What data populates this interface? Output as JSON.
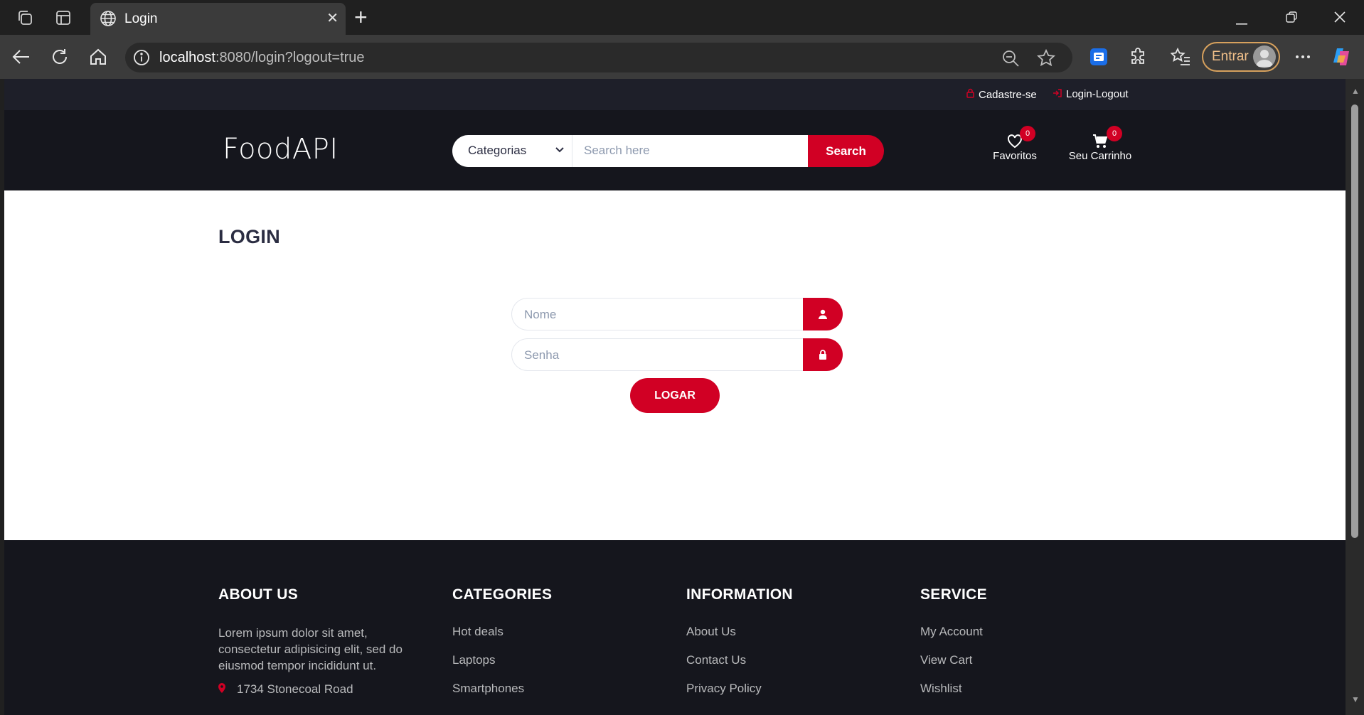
{
  "browser": {
    "tab_title": "Login",
    "url_host": "localhost",
    "url_rest": ":8080/login?logout=true",
    "profile_label": "Entrar"
  },
  "site": {
    "top_links": {
      "register": "Cadastre-se",
      "login_logout": "Login-Logout"
    },
    "logo": "FoodAPI",
    "search": {
      "category_selected": "Categorias",
      "placeholder": "Search here",
      "button": "Search"
    },
    "favorites": {
      "label": "Favoritos",
      "count": "0"
    },
    "cart": {
      "label": "Seu Carrinho",
      "count": "0"
    }
  },
  "login": {
    "title": "LOGIN",
    "name_placeholder": "Nome",
    "password_placeholder": "Senha",
    "submit": "LOGAR"
  },
  "footer": {
    "about": {
      "heading": "ABOUT US",
      "text": "Lorem ipsum dolor sit amet, consectetur adipisicing elit, sed do eiusmod tempor incididunt ut.",
      "address": "1734 Stonecoal Road"
    },
    "categories": {
      "heading": "CATEGORIES",
      "items": [
        "Hot deals",
        "Laptops",
        "Smartphones"
      ]
    },
    "information": {
      "heading": "INFORMATION",
      "items": [
        "About Us",
        "Contact Us",
        "Privacy Policy"
      ]
    },
    "service": {
      "heading": "SERVICE",
      "items": [
        "My Account",
        "View Cart",
        "Wishlist"
      ]
    }
  },
  "colors": {
    "accent": "#D10024",
    "header_bg": "#15161D",
    "topbar_bg": "#1E1F29",
    "title": "#2B2D42"
  }
}
